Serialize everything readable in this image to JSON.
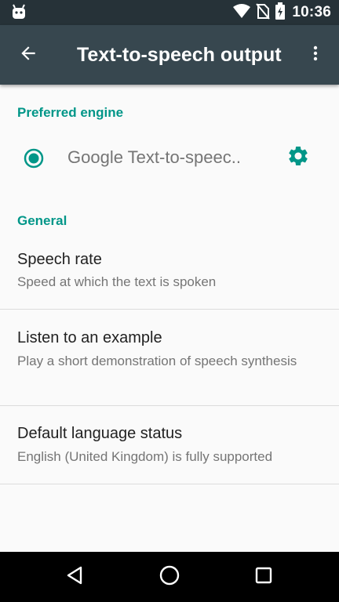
{
  "status_bar": {
    "time": "10:36",
    "icons": [
      "android-debug-icon",
      "wifi-icon",
      "no-sim-icon",
      "battery-charging-icon"
    ]
  },
  "toolbar": {
    "title": "Text-to-speech output",
    "back_icon": "arrow-back-icon",
    "overflow_icon": "more-vert-icon"
  },
  "preferred_engine": {
    "header": "Preferred engine",
    "engine_label": "Google Text-to-speec..",
    "selected": true,
    "settings_icon": "gear-icon"
  },
  "general": {
    "header": "General",
    "items": [
      {
        "title": "Speech rate",
        "summary": "Speed at which the text is spoken"
      },
      {
        "title": "Listen to an example",
        "summary": "Play a short demonstration of speech synthesis"
      },
      {
        "title": "Default language status",
        "summary": "English (United Kingdom) is fully supported"
      }
    ]
  },
  "nav_bar": {
    "buttons": [
      "back-triangle-icon",
      "home-circle-icon",
      "recents-square-icon"
    ]
  },
  "colors": {
    "accent": "#009688",
    "toolbar": "#37474f",
    "status_bar": "#263238",
    "background": "#fafafa"
  }
}
